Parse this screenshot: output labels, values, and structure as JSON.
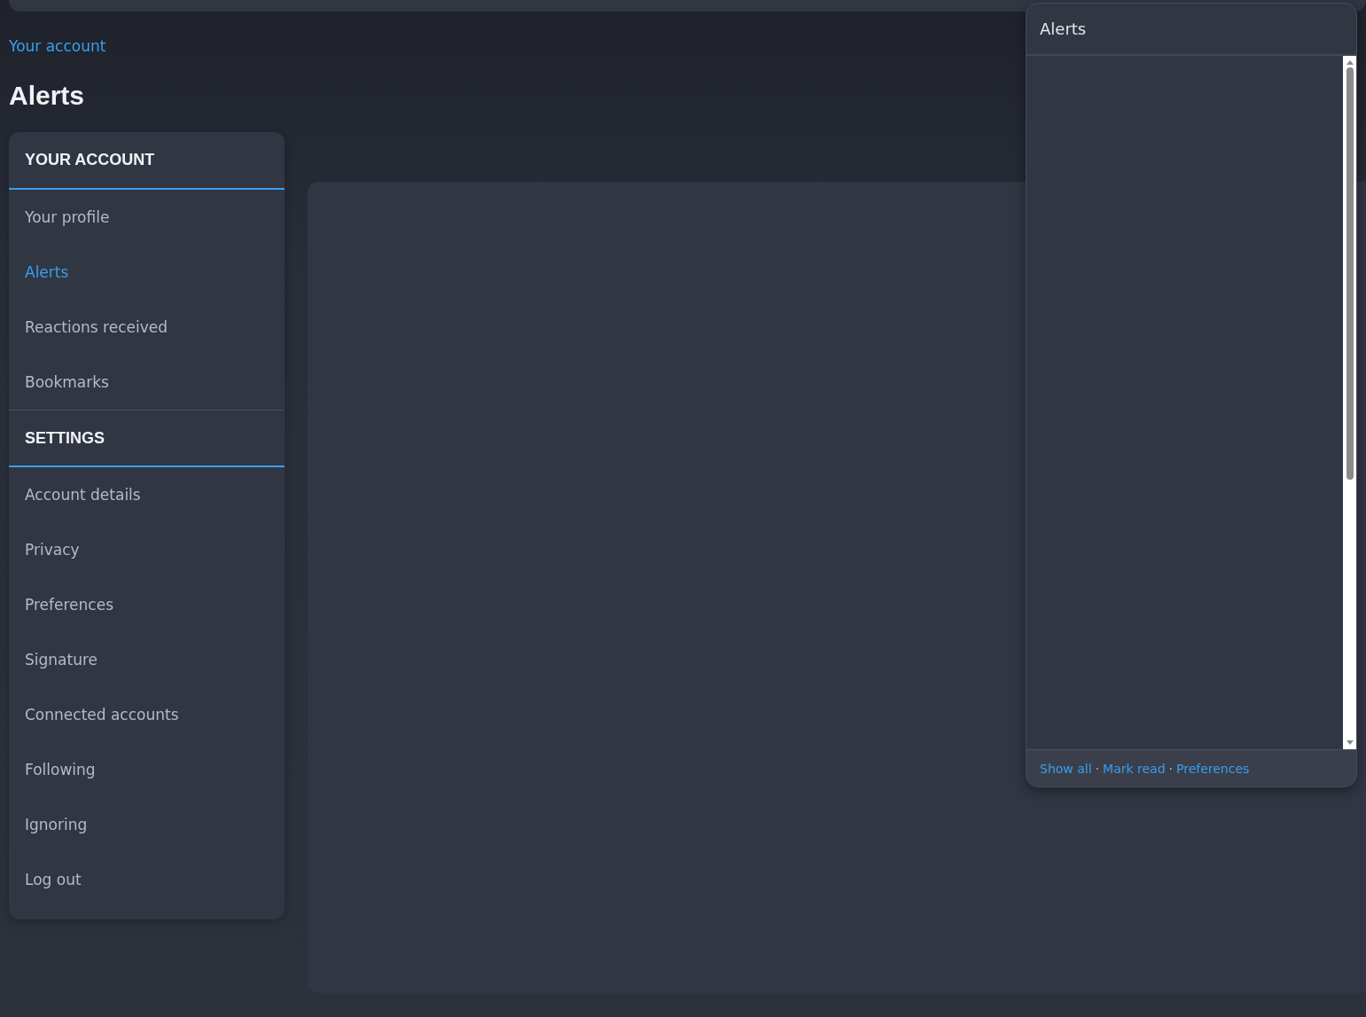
{
  "breadcrumb": "Your account",
  "page_title": "Alerts",
  "sidebar": {
    "sections": [
      {
        "title": "YOUR ACCOUNT",
        "items": [
          {
            "label": "Your profile",
            "selected": false
          },
          {
            "label": "Alerts",
            "selected": true
          },
          {
            "label": "Reactions received",
            "selected": false
          },
          {
            "label": "Bookmarks",
            "selected": false
          }
        ]
      },
      {
        "title": "SETTINGS",
        "items": [
          {
            "label": "Account details",
            "selected": false
          },
          {
            "label": "Privacy",
            "selected": false
          },
          {
            "label": "Preferences",
            "selected": false
          },
          {
            "label": "Signature",
            "selected": false
          },
          {
            "label": "Connected accounts",
            "selected": false
          },
          {
            "label": "Following",
            "selected": false
          },
          {
            "label": "Ignoring",
            "selected": false
          },
          {
            "label": "Log out",
            "selected": false
          }
        ]
      }
    ]
  },
  "alerts_popup": {
    "title": "Alerts",
    "footer_links": [
      "Show all",
      "Mark read",
      "Preferences"
    ],
    "separator": "·"
  }
}
